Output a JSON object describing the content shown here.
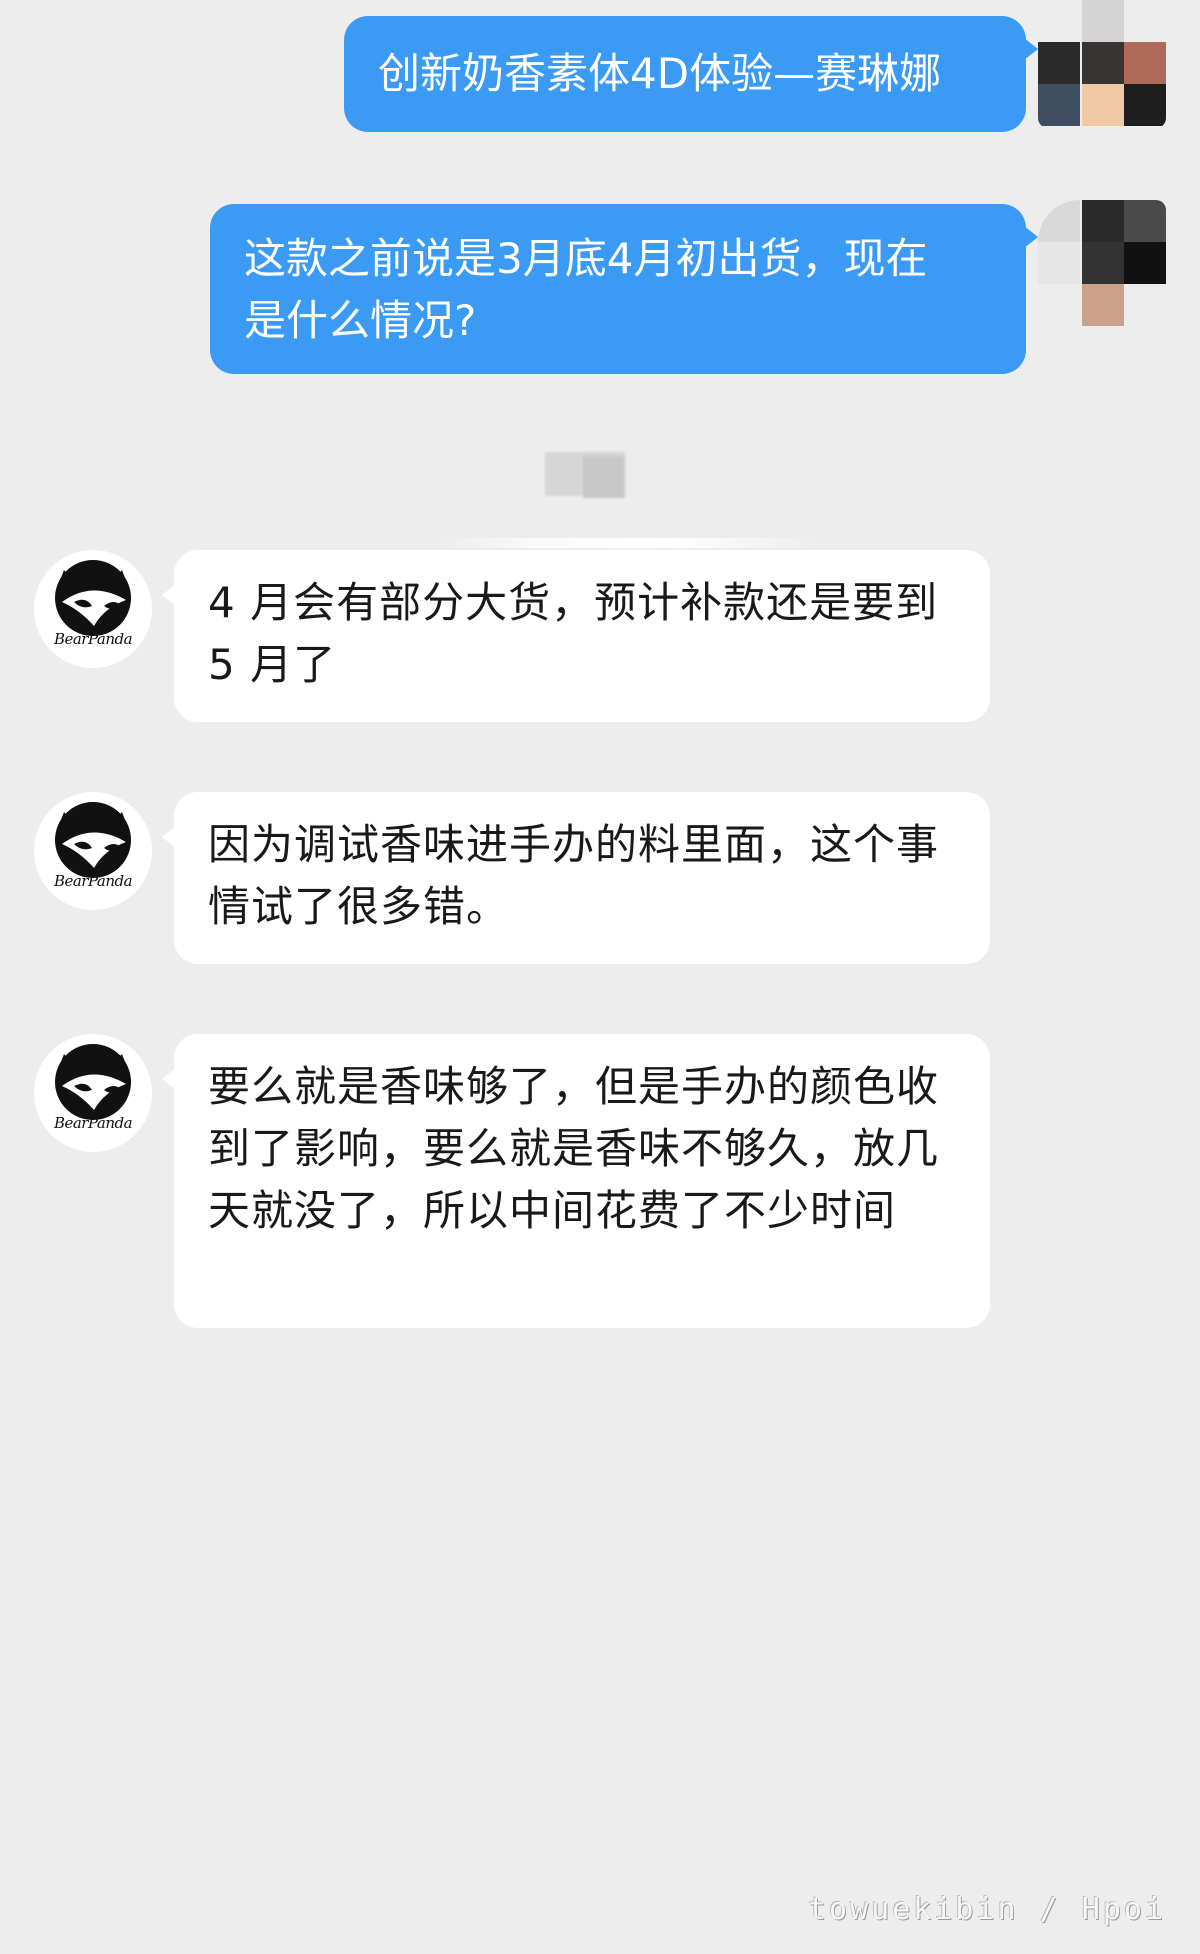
{
  "conversation": {
    "outgoing": [
      {
        "text": "创新奶香素体4D体验—赛琳娜"
      },
      {
        "line1": "这款之前说是3月底4月初出货，现在",
        "line2": "是什么情况?"
      }
    ],
    "incoming": [
      {
        "text": "4 月会有部分大货，预计补款还是要到 5 月了"
      },
      {
        "text": "因为调试香味进手办的料里面，这个事情试了很多错。"
      },
      {
        "text": "要么就是香味够了，但是手办的颜色收到了影响，要么就是香味不够久，放几天就没了，所以中间花费了不少时间"
      }
    ]
  },
  "shop_avatar": {
    "logo_text": "BearPanda",
    "icon": "bear-panda-logo-icon"
  },
  "self_avatar": {
    "icon": "pixelated-avatar-icon"
  },
  "watermark": {
    "text": "towuekibin / Hpoi"
  },
  "colors": {
    "background": "#ededed",
    "outgoing_bubble": "#3a9af4",
    "incoming_bubble": "#ffffff"
  }
}
